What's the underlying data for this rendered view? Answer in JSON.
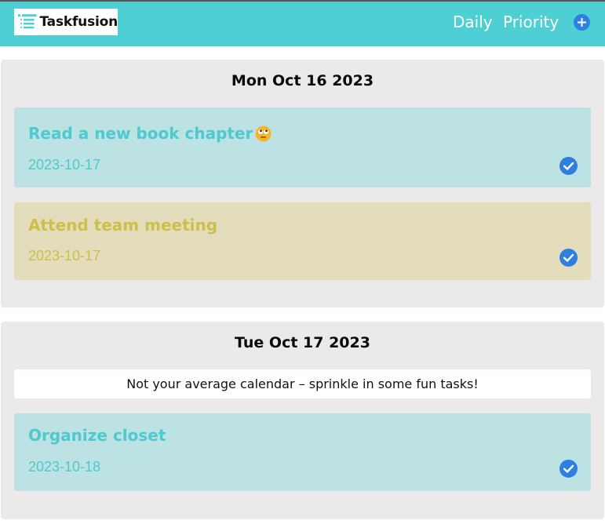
{
  "header": {
    "app_name": "Taskfusion",
    "logo_icon": "list-icon",
    "nav": [
      {
        "label": "Daily"
      },
      {
        "label": "Priority"
      }
    ],
    "add_icon": "plus-circle-icon"
  },
  "days": [
    {
      "title": "Mon Oct 16 2023",
      "tasks": [
        {
          "title": "Read a new book chapter",
          "emoji": "rolling-eyes-emoji",
          "date": "2023-10-17",
          "color": "#4ec9cd",
          "status": "done"
        },
        {
          "title": "Attend team meeting",
          "date": "2023-10-17",
          "color": "#cdbf4b",
          "status": "done"
        }
      ]
    },
    {
      "title": "Tue Oct 17 2023",
      "banner": "Not your average calendar – sprinkle in some fun tasks!",
      "tasks": [
        {
          "title": "Organize closet",
          "date": "2023-10-18",
          "color": "#4ec9cd",
          "status": "done"
        }
      ]
    }
  ],
  "colors": {
    "header_bg": "#4ecfd4",
    "accent_blue": "#2f7fe0",
    "card_bg": "#ebe9ea",
    "task_teal_bg": "#bce2e3",
    "task_yellow_bg": "#e3ddbb"
  }
}
